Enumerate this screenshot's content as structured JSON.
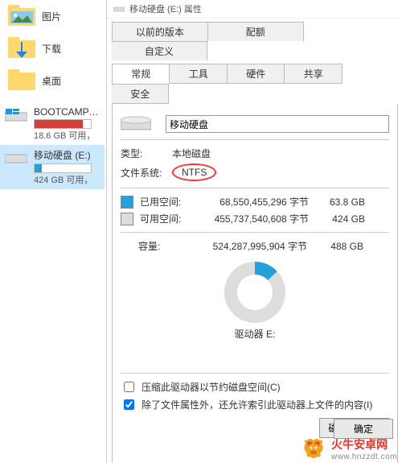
{
  "sidebar": {
    "folders": [
      {
        "label": "图片"
      },
      {
        "label": "下载"
      },
      {
        "label": "桌面"
      }
    ],
    "drives": [
      {
        "name": "BOOTCAMP (C:)",
        "sub": "18.6 GB 可用，",
        "fill_pct": 86,
        "warn": true
      },
      {
        "name": "移动硬盘 (E:)",
        "sub": "424 GB 可用，",
        "fill_pct": 13,
        "warn": false
      }
    ]
  },
  "properties": {
    "window_title": "移动硬盘 (E:) 属性",
    "tabs_top": [
      "以前的版本",
      "配额",
      "自定义"
    ],
    "tabs_bottom": [
      "常规",
      "工具",
      "硬件",
      "共享",
      "安全"
    ],
    "active_tab": "常规",
    "name_value": "移动硬盘",
    "rows": {
      "type_label": "类型:",
      "type_value": "本地磁盘",
      "fs_label": "文件系统:",
      "fs_value": "NTFS"
    },
    "usage": {
      "used_label": "已用空间:",
      "used_bytes": "68,550,455,296 字节",
      "used_h": "63.8 GB",
      "free_label": "可用空间:",
      "free_bytes": "455,737,540,608 字节",
      "free_h": "424 GB",
      "cap_label": "容量:",
      "cap_bytes": "524,287,995,904 字节",
      "cap_h": "488 GB"
    },
    "donut": {
      "used_pct": 13
    },
    "drive_label": "驱动器 E:",
    "cleanup_btn": "磁盘清理(D)",
    "chk1": "压缩此驱动器以节约磁盘空间(C)",
    "chk2": "除了文件属性外，还允许索引此驱动器上文件的内容(I)",
    "ok": "确定"
  },
  "watermark": {
    "main": "火牛安卓网",
    "sub": "www.hnzzdt.com"
  }
}
